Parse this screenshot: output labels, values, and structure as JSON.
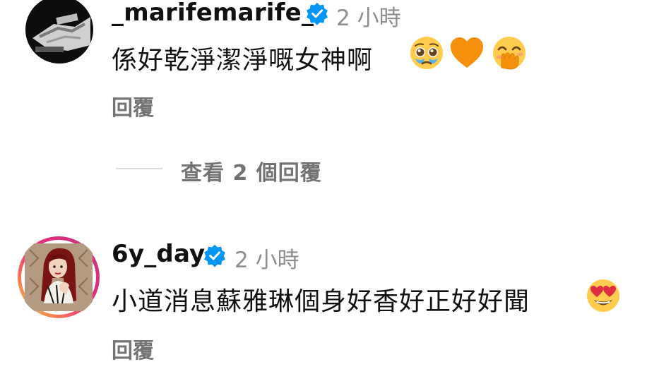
{
  "comments": [
    {
      "username": "_marifemarife_",
      "timestamp": "2 小時",
      "text": "係好乾淨潔淨嘅女神啊",
      "emojis": [
        "pleading-face-icon",
        "orange-heart-icon",
        "hand-over-mouth-icon"
      ],
      "reply_label": "回覆",
      "view_replies_label": "查看 2 個回覆"
    },
    {
      "username": "6y_day",
      "timestamp": "2 小時",
      "text": "小道消息蘇雅琳個身好香好正好好聞",
      "emojis": [
        "heart-eyes-icon"
      ],
      "reply_label": "回覆"
    }
  ],
  "colors": {
    "verified_blue": "#0095f6",
    "secondary_text": "#737373",
    "timestamp": "#8e8e8e",
    "story_ring_start": "#f9ce34",
    "story_ring_mid": "#ee2a7b",
    "story_ring_end": "#c13584"
  }
}
